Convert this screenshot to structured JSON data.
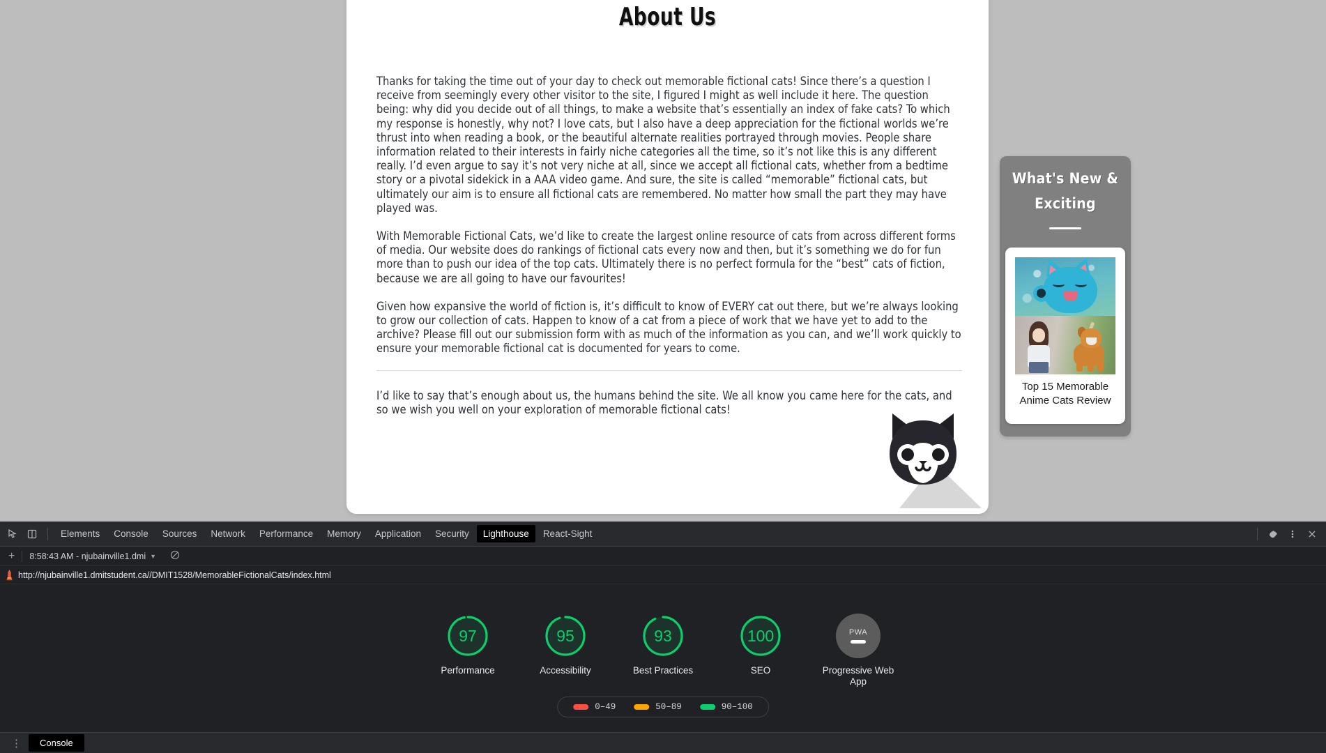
{
  "page": {
    "title": "About Us",
    "paragraphs": [
      "Thanks for taking the time out of your day to check out memorable fictional cats! Since there’s a question I receive from seemingly every other visitor to the site, I figured I might as well include it here. The question being: why did you decide out of all things, to make a website that’s essentially an index of fake cats? To which my response is honestly, why not? I love cats, but I also have a deep appreciation for the fictional worlds we’re thrust into when reading a book, or the beautiful alternate realities portrayed through movies. People share information related to their interests in fairly niche categories all the time, so it’s not like this is any different really. I’d even argue to say it’s not very niche at all, since we accept all fictional cats, whether from a bedtime story or a pivotal sidekick in a AAA video game. And sure, the site is called “memorable” fictional cats, but ultimately our aim is to ensure all fictional cats are remembered. No matter how small the part they may have played was.",
      "With Memorable Fictional Cats, we’d like to create the largest online resource of cats from across different forms of media. Our website does do rankings of fictional cats every now and then, but it’s something we do for fun more than to push our idea of the top cats. Ultimately there is no perfect formula for the “best” cats of fiction, because we are all going to have our favourites!",
      "Given how expansive the world of fiction is, it’s difficult to know of EVERY cat out there, but we’re always looking to grow our collection of cats. Happen to know of a cat from a piece of work that we have yet to add to the archive? Please fill out our submission form with as much of the information as you can, and we’ll work quickly to ensure your memorable fictional cat is documented for years to come."
    ],
    "closing": "I’d like to say that’s enough about us, the humans behind the site. We all know you came here for the cats, and so we wish you well on your exploration of memorable fictional cats!"
  },
  "sidebar": {
    "heading": "What's New & Exciting",
    "card_title": "Top 15 Memorable Anime Cats Review"
  },
  "devtools": {
    "tabs": [
      {
        "label": "Elements",
        "active": false
      },
      {
        "label": "Console",
        "active": false
      },
      {
        "label": "Sources",
        "active": false
      },
      {
        "label": "Network",
        "active": false
      },
      {
        "label": "Performance",
        "active": false
      },
      {
        "label": "Memory",
        "active": false
      },
      {
        "label": "Application",
        "active": false
      },
      {
        "label": "Security",
        "active": false
      },
      {
        "label": "Lighthouse",
        "active": true
      },
      {
        "label": "React-Sight",
        "active": false
      }
    ],
    "run_label": "8:58:43 AM - njubainville1.dmi",
    "url": "http://njubainville1.dmitstudent.ca//DMIT1528/MemorableFictionalCats/index.html",
    "drawer_tab": "Console",
    "plus_label": "+"
  },
  "lighthouse": {
    "gauges": [
      {
        "value": "97",
        "label": "Performance",
        "color": "#0cce6b",
        "pct": 97
      },
      {
        "value": "95",
        "label": "Accessibility",
        "color": "#0cce6b",
        "pct": 95
      },
      {
        "value": "93",
        "label": "Best Practices",
        "color": "#0cce6b",
        "pct": 93
      },
      {
        "value": "100",
        "label": "SEO",
        "color": "#0cce6b",
        "pct": 100
      }
    ],
    "pwa": {
      "badge_text": "PWA",
      "label": "Progressive Web App",
      "color": "#5c5c5c"
    },
    "legend": [
      {
        "range": "0–49",
        "color": "#ff4e42"
      },
      {
        "range": "50–89",
        "color": "#ffa400"
      },
      {
        "range": "90–100",
        "color": "#0cce6b"
      }
    ]
  }
}
